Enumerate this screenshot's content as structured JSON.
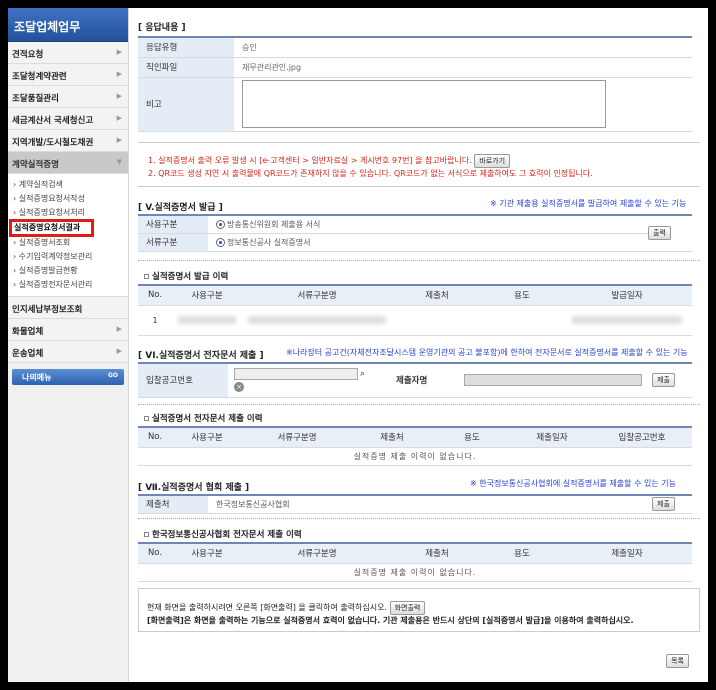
{
  "sidebar": {
    "title": "조달업체업무",
    "items": [
      {
        "label": "견적요청"
      },
      {
        "label": "조달청계약관련"
      },
      {
        "label": "조달품질관리"
      },
      {
        "label": "세금계산서 국세청신고"
      },
      {
        "label": "지역개발/도시철도채권"
      }
    ],
    "active_item": "계약실적증명",
    "sub_items": [
      "계약실적검색",
      "실적증명요청서작성",
      "실적증명요청서처리",
      "실적증명요청서결과",
      "실적증명서조회",
      "수기입력계약정보관리",
      "실적증명발급현황",
      "실적증명전자문서관리"
    ],
    "highlighted_sub": "실적증명요청서결과",
    "bottom_items": [
      "인지세납부정보조회",
      "화물업체",
      "운송업체"
    ],
    "mymenu_label": "나의메뉴",
    "mymenu_go": "GO"
  },
  "response": {
    "title": "[ 응답내용 ]",
    "type_label": "응답유형",
    "type_value": "승인",
    "seal_label": "직인파일",
    "seal_value": "재무관리관인.jpg",
    "remark_label": "비고"
  },
  "notices": {
    "line1": "1. 실적증명서 출력 오류 발생 시 [e-고객센터 > 일반자료실 > 게시번호 97번] 을 참고바랍니다.",
    "line1_button": "바로가기",
    "line2": "2. QR코드 생성 지연 시 출력물에 QR코드가 존재하지 않을 수 있습니다. QR코드가 없는 서식으로 제출하여도 그 효력이 인정됩니다."
  },
  "issue": {
    "title": "[ V.실적증명서 발급 ]",
    "note": "※ 기관 제출용 실적증명서를 발급하여 제출할 수 있는 기능",
    "usage_label": "사용구분",
    "usage_value": "방송통신위원회 제출용 서식",
    "doc_label": "서류구분",
    "doc_value": "정보통신공사 실적증명서",
    "print_button": "출력"
  },
  "issue_history": {
    "title": "실적증명서 발급 이력",
    "columns": [
      "No.",
      "사용구분",
      "서류구분명",
      "제출처",
      "용도",
      "발급일자"
    ],
    "rows": [
      [
        "1",
        "",
        "",
        "",
        "",
        ""
      ]
    ]
  },
  "edoc": {
    "title": "[ VI.실적증명서 전자문서 제출 ]",
    "note": "※나라장터 공고건(자체전자조달시스템 운영기관의 공고 불포함)에 한하여 전자문서로 실적증명서를 제출할 수 있는 기능",
    "bid_label": "입찰공고번호",
    "submitter_label": "제출자명",
    "submit_button": "제출"
  },
  "edoc_history": {
    "title": "실적증명서 전자문서 제출 이력",
    "columns": [
      "No.",
      "사용구분",
      "서류구분명",
      "제출처",
      "용도",
      "제출일자",
      "입찰공고번호"
    ],
    "empty": "실적증명 제출 이력이 없습니다."
  },
  "assoc": {
    "title": "[ Ⅶ.실적증명서 협회 제출 ]",
    "note": "※ 한국정보통신공사협회에 실적증명서를 제출할 수 있는 기능",
    "dest_label": "제출처",
    "dest_value": "한국정보통신공사협회",
    "submit_button": "제출"
  },
  "assoc_history": {
    "title": "한국정보통신공사협회 전자문서 제출 이력",
    "columns": [
      "No.",
      "사용구분",
      "서류구분명",
      "제출처",
      "용도",
      "제출일자"
    ],
    "empty": "실적증명 제출 이력이 없습니다."
  },
  "footer": {
    "line1": "현재 화면을 출력하시려면 오른쪽 [화면출력] 을 클릭하여 출력하십시오.",
    "print_screen_button": "화면출력",
    "line2": "[화면출력]은 화면을 출력하는 기능으로 실적증명서 효력이 없습니다. 기관 제출용은 반드시 상단의 [실적증명서 발급]을 이용하여 출력하십시오.",
    "list_button": "목록"
  },
  "colors": {
    "accent": "#2a52a8",
    "notice_red": "#d9241b",
    "note_blue": "#2a3fd6",
    "highlight_red": "#e21b1b"
  }
}
